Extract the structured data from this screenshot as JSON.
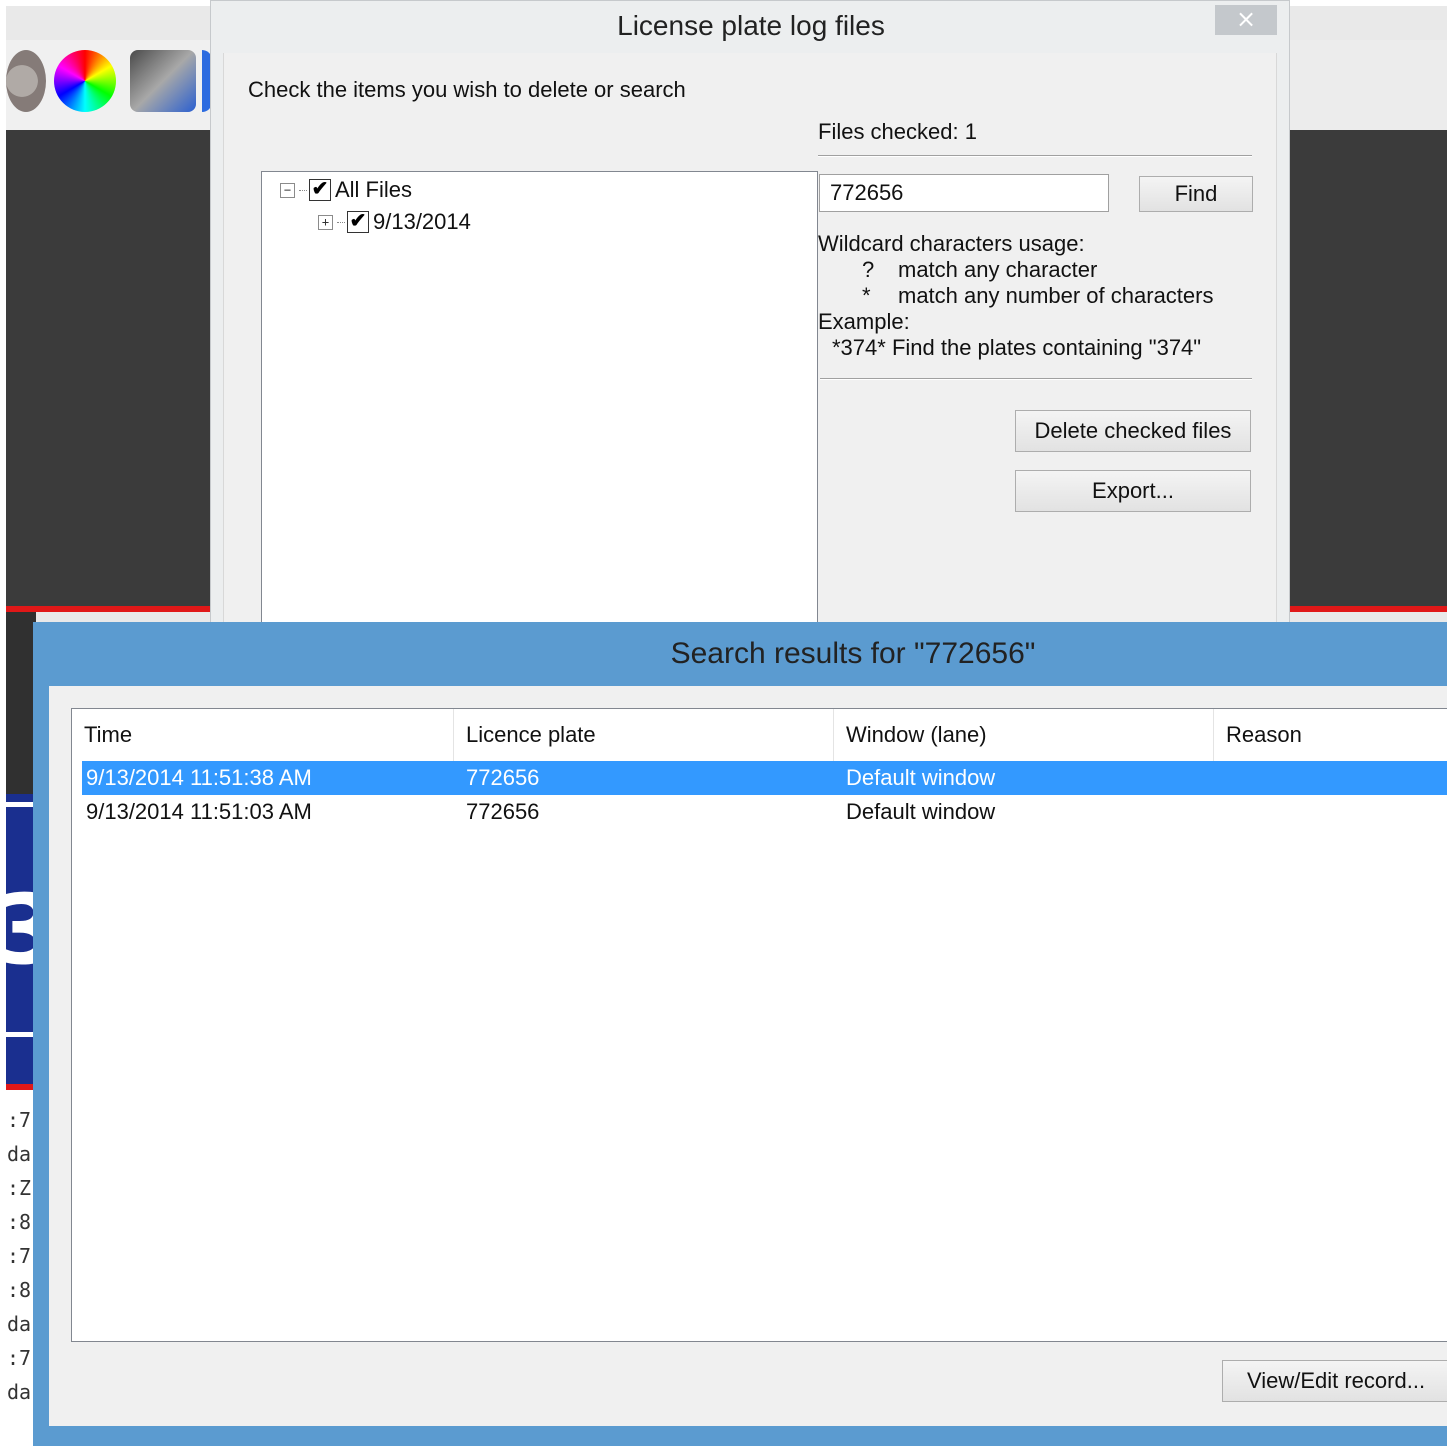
{
  "license_dialog": {
    "title": "License plate log files",
    "close_glyph": "×",
    "instruction": "Check the items you wish to delete or search",
    "tree": {
      "root_label": "All Files",
      "root_expander": "−",
      "child_label": "9/13/2014",
      "child_expander": "+",
      "check_glyph": "✔"
    },
    "files_checked": "Files checked: 1",
    "search_value": "772656",
    "find_label": "Find",
    "wildcard_heading": "Wildcard characters usage:",
    "wildcards": [
      {
        "symbol": "?",
        "description": "match any character"
      },
      {
        "symbol": "*",
        "description": "match any number of characters"
      }
    ],
    "example_heading": "Example:",
    "example_text": "*374* Find the plates containing \"374\"",
    "delete_label": "Delete checked files",
    "export_label": "Export..."
  },
  "results_dialog": {
    "title": "Search results for \"772656\"",
    "columns": [
      "Time",
      "Licence plate",
      "Window (lane)",
      "Reason"
    ],
    "rows": [
      {
        "time": "9/13/2014 11:51:38 AM",
        "plate": "772656",
        "window": "Default window",
        "reason": "",
        "selected": true
      },
      {
        "time": "9/13/2014 11:51:03 AM",
        "plate": "772656",
        "window": "Default window",
        "reason": "",
        "selected": false
      }
    ],
    "view_edit_label": "View/Edit record..."
  },
  "background": {
    "plate_char": "3",
    "log_fragments": [
      ":7",
      "da",
      ":Z",
      ":8",
      ":7",
      ":8",
      "da",
      ":7",
      "da"
    ]
  },
  "colors": {
    "selection": "#3399ff",
    "results_frame": "#5b9bd0",
    "alert_red": "#e01818"
  }
}
